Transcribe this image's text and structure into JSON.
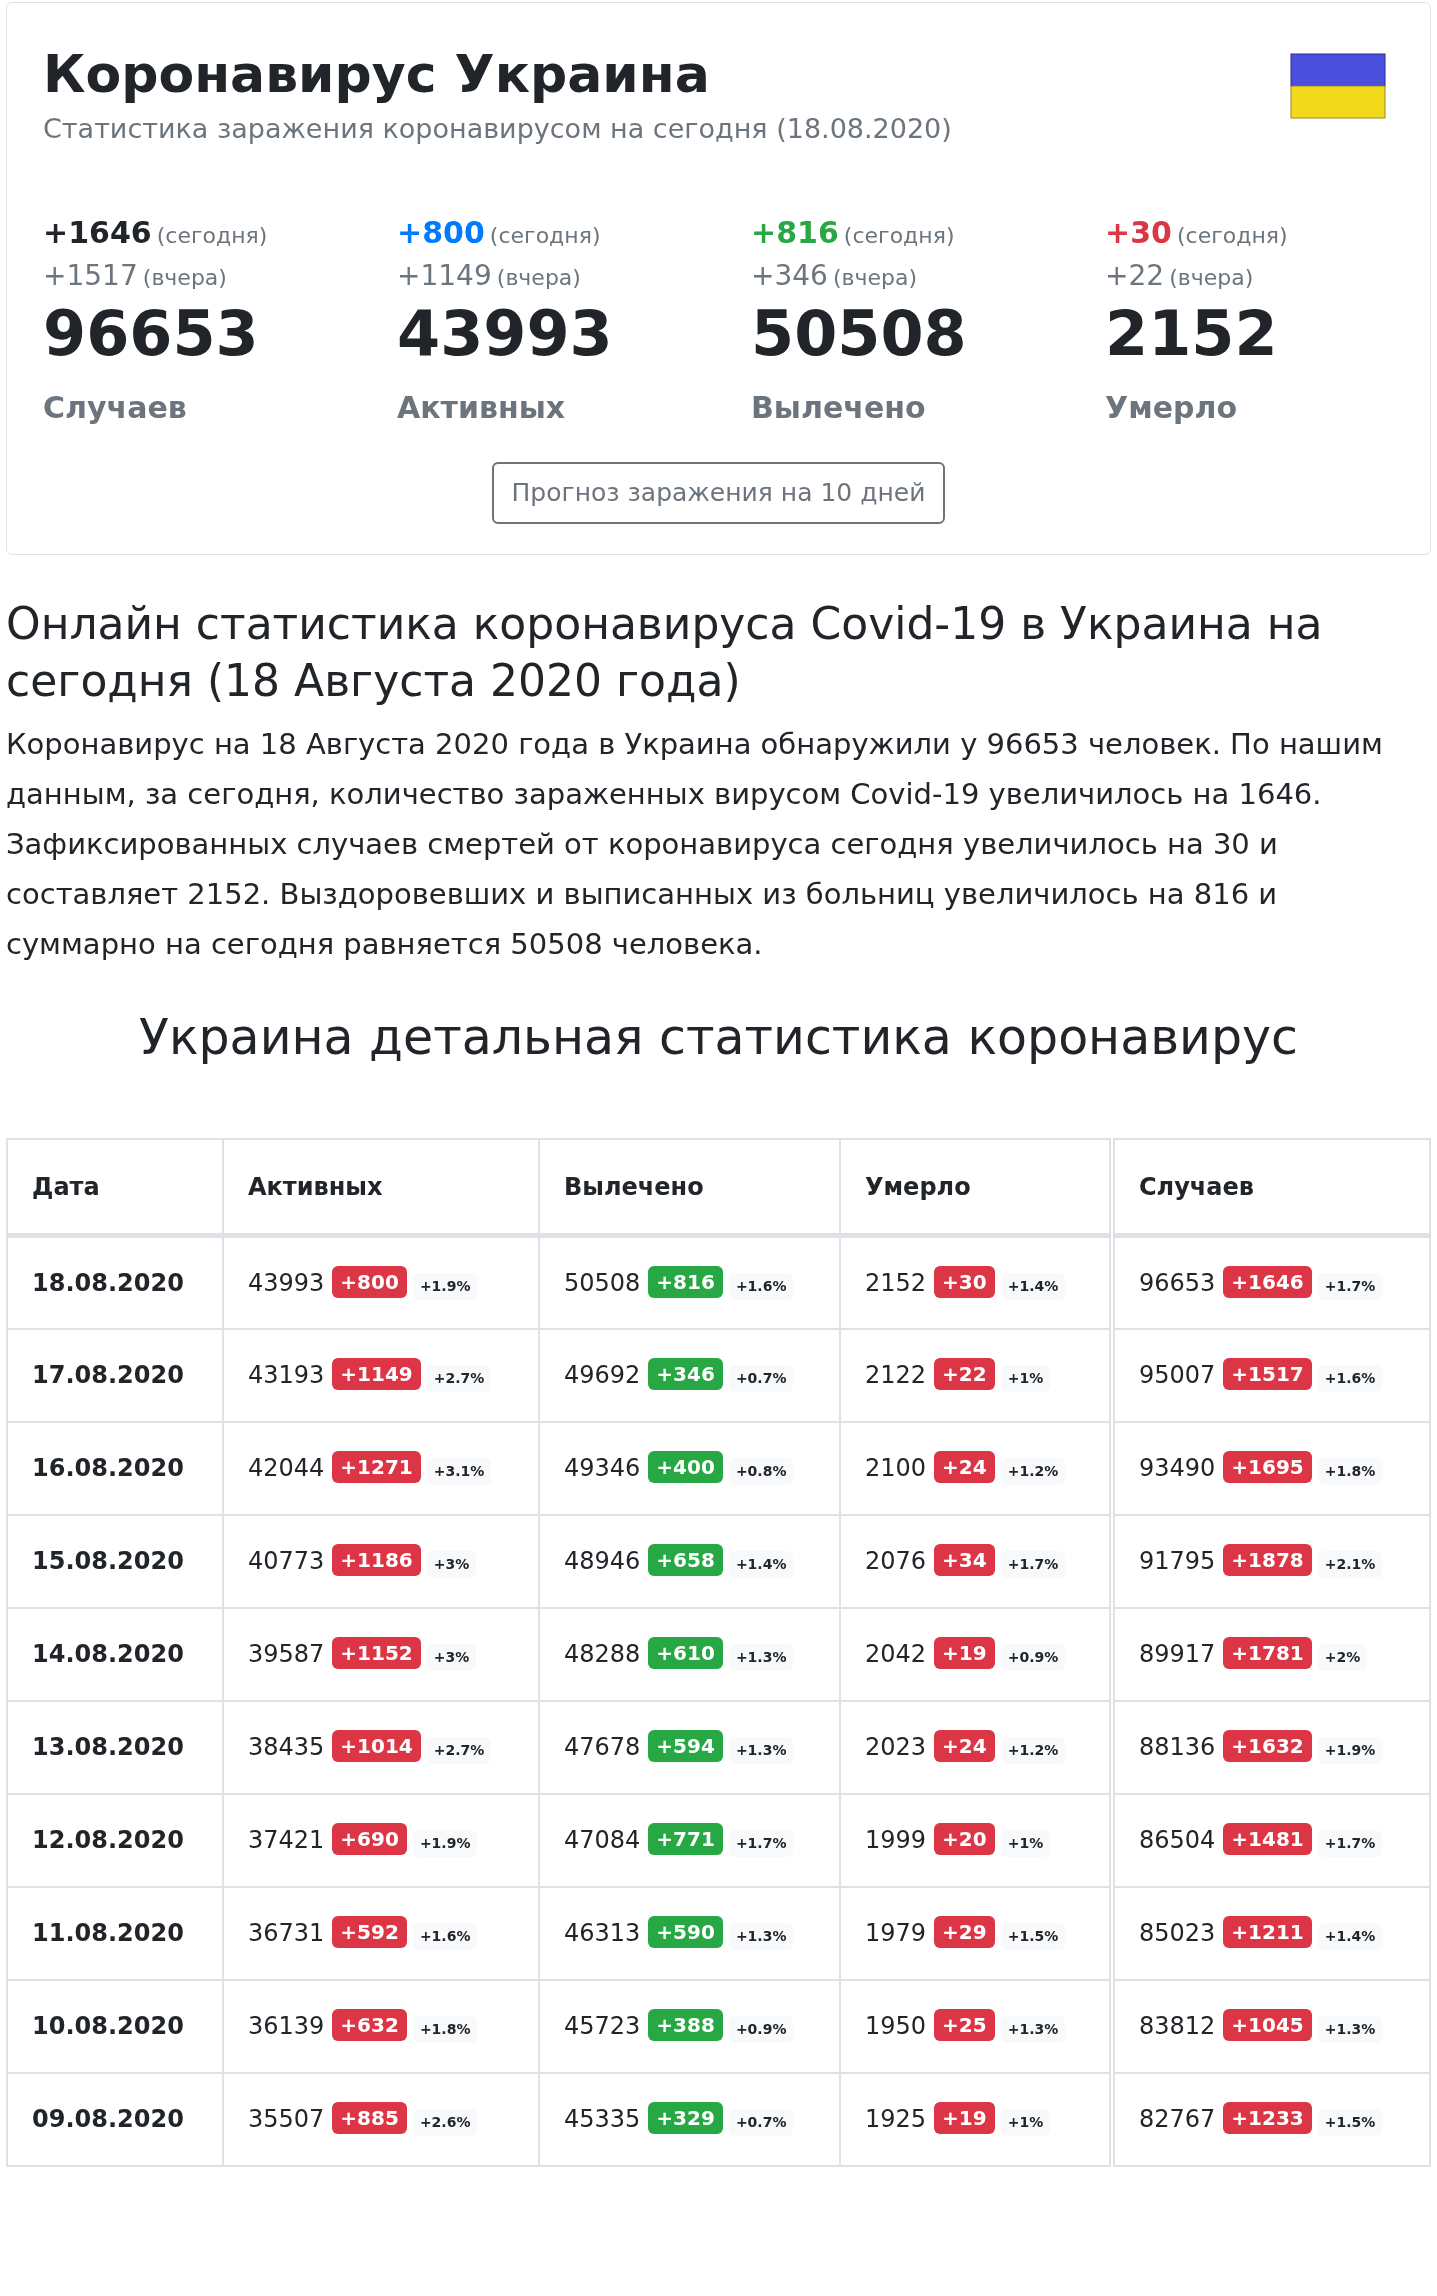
{
  "header": {
    "title": "Коронавирус Украина",
    "subtitle": "Статистика заражения коронавирусом на сегодня (18.08.2020)"
  },
  "stats": [
    {
      "today": "+1646",
      "today_label": "(сегодня)",
      "yesterday": "+1517",
      "yesterday_label": "(вчера)",
      "total": "96653",
      "label": "Случаев",
      "color": "#212529"
    },
    {
      "today": "+800",
      "today_label": "(сегодня)",
      "yesterday": "+1149",
      "yesterday_label": "(вчера)",
      "total": "43993",
      "label": "Активных",
      "color": "#007bff"
    },
    {
      "today": "+816",
      "today_label": "(сегодня)",
      "yesterday": "+346",
      "yesterday_label": "(вчера)",
      "total": "50508",
      "label": "Вылечено",
      "color": "#28a745"
    },
    {
      "today": "+30",
      "today_label": "(сегодня)",
      "yesterday": "+22",
      "yesterday_label": "(вчера)",
      "total": "2152",
      "label": "Умерло",
      "color": "#dc3545"
    }
  ],
  "forecast_button": "Прогноз заражения на 10 дней",
  "article": {
    "title": "Онлайн статистика коронавируса Covid-19 в Украина на сегодня (18 Августа 2020 года)",
    "text": "Коронавирус на 18 Августа 2020 года в Украина обнаружили у 96653 человек. По нашим данным, за сегодня, количество зараженных вирусом Covid-19 увеличилось на 1646. Зафиксированных случаев смертей от коронавируса сегодня увеличилось на 30 и составляет 2152. Выздоровевших и выписанных из больниц увеличилось на 816 и суммарно на сегодня равняется 50508 человека."
  },
  "table_title": "Украина детальная статистика коронавирус",
  "table": {
    "date_column": "Дата",
    "columns": [
      {
        "label": "Активных",
        "color": "#dc3545"
      },
      {
        "label": "Вылечено",
        "color": "#28a745"
      },
      {
        "label": "Умерло",
        "color": "#dc3545"
      },
      {
        "label": "Случаев",
        "color": "#dc3545"
      }
    ],
    "rows": [
      {
        "date": "18.08.2020",
        "cells": [
          [
            "43993",
            "+800",
            "+1.9%"
          ],
          [
            "50508",
            "+816",
            "+1.6%"
          ],
          [
            "2152",
            "+30",
            "+1.4%"
          ],
          [
            "96653",
            "+1646",
            "+1.7%"
          ]
        ]
      },
      {
        "date": "17.08.2020",
        "cells": [
          [
            "43193",
            "+1149",
            "+2.7%"
          ],
          [
            "49692",
            "+346",
            "+0.7%"
          ],
          [
            "2122",
            "+22",
            "+1%"
          ],
          [
            "95007",
            "+1517",
            "+1.6%"
          ]
        ]
      },
      {
        "date": "16.08.2020",
        "cells": [
          [
            "42044",
            "+1271",
            "+3.1%"
          ],
          [
            "49346",
            "+400",
            "+0.8%"
          ],
          [
            "2100",
            "+24",
            "+1.2%"
          ],
          [
            "93490",
            "+1695",
            "+1.8%"
          ]
        ]
      },
      {
        "date": "15.08.2020",
        "cells": [
          [
            "40773",
            "+1186",
            "+3%"
          ],
          [
            "48946",
            "+658",
            "+1.4%"
          ],
          [
            "2076",
            "+34",
            "+1.7%"
          ],
          [
            "91795",
            "+1878",
            "+2.1%"
          ]
        ]
      },
      {
        "date": "14.08.2020",
        "cells": [
          [
            "39587",
            "+1152",
            "+3%"
          ],
          [
            "48288",
            "+610",
            "+1.3%"
          ],
          [
            "2042",
            "+19",
            "+0.9%"
          ],
          [
            "89917",
            "+1781",
            "+2%"
          ]
        ]
      },
      {
        "date": "13.08.2020",
        "cells": [
          [
            "38435",
            "+1014",
            "+2.7%"
          ],
          [
            "47678",
            "+594",
            "+1.3%"
          ],
          [
            "2023",
            "+24",
            "+1.2%"
          ],
          [
            "88136",
            "+1632",
            "+1.9%"
          ]
        ]
      },
      {
        "date": "12.08.2020",
        "cells": [
          [
            "37421",
            "+690",
            "+1.9%"
          ],
          [
            "47084",
            "+771",
            "+1.7%"
          ],
          [
            "1999",
            "+20",
            "+1%"
          ],
          [
            "86504",
            "+1481",
            "+1.7%"
          ]
        ]
      },
      {
        "date": "11.08.2020",
        "cells": [
          [
            "36731",
            "+592",
            "+1.6%"
          ],
          [
            "46313",
            "+590",
            "+1.3%"
          ],
          [
            "1979",
            "+29",
            "+1.5%"
          ],
          [
            "85023",
            "+1211",
            "+1.4%"
          ]
        ]
      },
      {
        "date": "10.08.2020",
        "cells": [
          [
            "36139",
            "+632",
            "+1.8%"
          ],
          [
            "45723",
            "+388",
            "+0.9%"
          ],
          [
            "1950",
            "+25",
            "+1.3%"
          ],
          [
            "83812",
            "+1045",
            "+1.3%"
          ]
        ]
      },
      {
        "date": "09.08.2020",
        "cells": [
          [
            "35507",
            "+885",
            "+2.6%"
          ],
          [
            "45335",
            "+329",
            "+0.7%"
          ],
          [
            "1925",
            "+19",
            "+1%"
          ],
          [
            "82767",
            "+1233",
            "+1.5%"
          ]
        ]
      }
    ]
  }
}
